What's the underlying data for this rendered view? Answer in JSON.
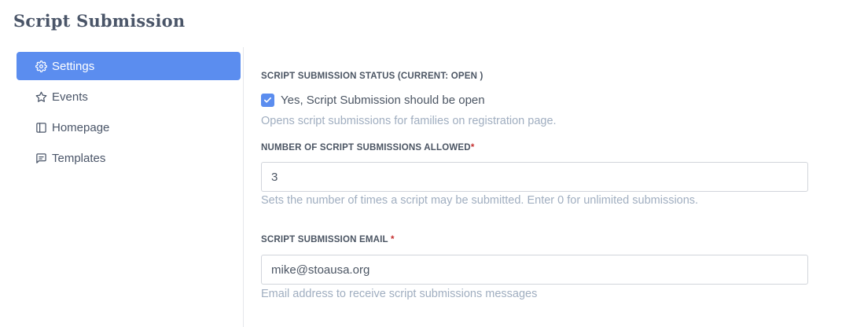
{
  "page": {
    "title": "Script Submission"
  },
  "sidebar": {
    "items": [
      {
        "label": "Settings",
        "icon": "gear-icon",
        "active": true
      },
      {
        "label": "Events",
        "icon": "star-icon",
        "active": false
      },
      {
        "label": "Homepage",
        "icon": "layout-icon",
        "active": false
      },
      {
        "label": "Templates",
        "icon": "message-icon",
        "active": false
      }
    ]
  },
  "form": {
    "status": {
      "label": "SCRIPT SUBMISSION STATUS (CURRENT: OPEN )",
      "checkbox_label": "Yes, Script Submission should be open",
      "checked": true,
      "help": "Opens script submissions for families on registration page."
    },
    "count": {
      "label": "NUMBER OF SCRIPT SUBMISSIONS ALLOWED",
      "required_mark": "*",
      "value": "3",
      "help": "Sets the number of times a script may be submitted. Enter 0 for unlimited submissions."
    },
    "email": {
      "label": "SCRIPT SUBMISSION EMAIL ",
      "required_mark": "*",
      "value": "mike@stoausa.org",
      "help": "Email address to receive script submissions messages"
    }
  },
  "colors": {
    "accent": "#5b8def",
    "required": "#c53030",
    "help_text": "#a0aec0"
  }
}
